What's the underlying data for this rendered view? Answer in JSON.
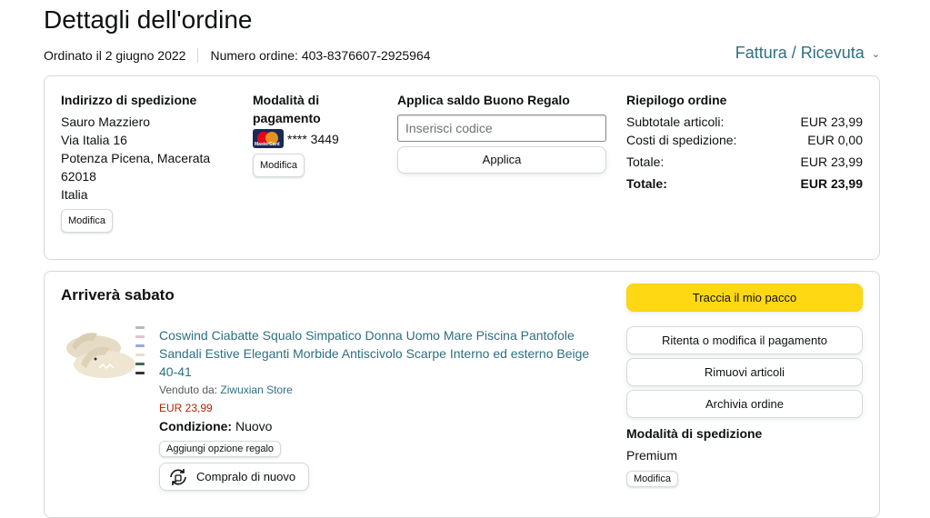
{
  "header": {
    "title": "Dettagli dell'ordine",
    "ordered": "Ordinato il 2 giugno 2022",
    "order_number": "Numero ordine: 403-8376607-2925964",
    "invoice": "Fattura / Ricevuta",
    "invoice_icon": "chevron-down-icon"
  },
  "shipping": {
    "heading": "Indirizzo di spedizione",
    "lines": [
      "Sauro Mazziero",
      "Via Italia 16",
      "Potenza Picena, Macerata",
      "62018",
      "Italia"
    ],
    "edit": "Modifica"
  },
  "payment": {
    "heading_line1": "Modalità di",
    "heading_line2": "pagamento",
    "card_brand": "MasterCard",
    "card_number": "**** 3449",
    "edit": "Modifica"
  },
  "gift": {
    "heading": "Applica saldo Buono Regalo",
    "placeholder": "Inserisci codice",
    "apply": "Applica"
  },
  "summary": {
    "heading": "Riepilogo ordine",
    "rows": [
      {
        "label": "Subtotale articoli:",
        "value": "EUR 23,99"
      },
      {
        "label": "Costi di spedizione:",
        "value": "EUR 0,00"
      },
      {
        "label": "Totale:",
        "value": "EUR 23,99"
      },
      {
        "label": "Totale:",
        "value": "EUR 23,99"
      }
    ]
  },
  "shipment": {
    "arrival": "Arriverà sabato",
    "product_title": "Coswind Ciabatte Squalo Simpatico Donna Uomo Mare Piscina Pantofole Sandali Estive Eleganti Morbide Antiscivolo Scarpe Interno ed esterno Beige 40-41",
    "sold_by_label": "Venduto da: ",
    "seller": "Ziwuxian Store",
    "price": "EUR 23,99",
    "condition_label": "Condizione:",
    "condition_value": " Nuovo",
    "gift_option": "Aggiungi opzione regalo",
    "buy_again": "Compralo di nuovo",
    "track": "Traccia il mio pacco",
    "retry_payment": "Ritenta o modifica il pagamento",
    "remove_items": "Rimuovi articoli",
    "archive": "Archivia ordine",
    "ship_method_heading": "Modalità di spedizione",
    "ship_method": "Premium",
    "edit": "Modifica"
  },
  "colors": {
    "link": "#2f6f80",
    "price": "#b12704",
    "track_button": "#ffd814",
    "border": "#d5d9d9"
  }
}
